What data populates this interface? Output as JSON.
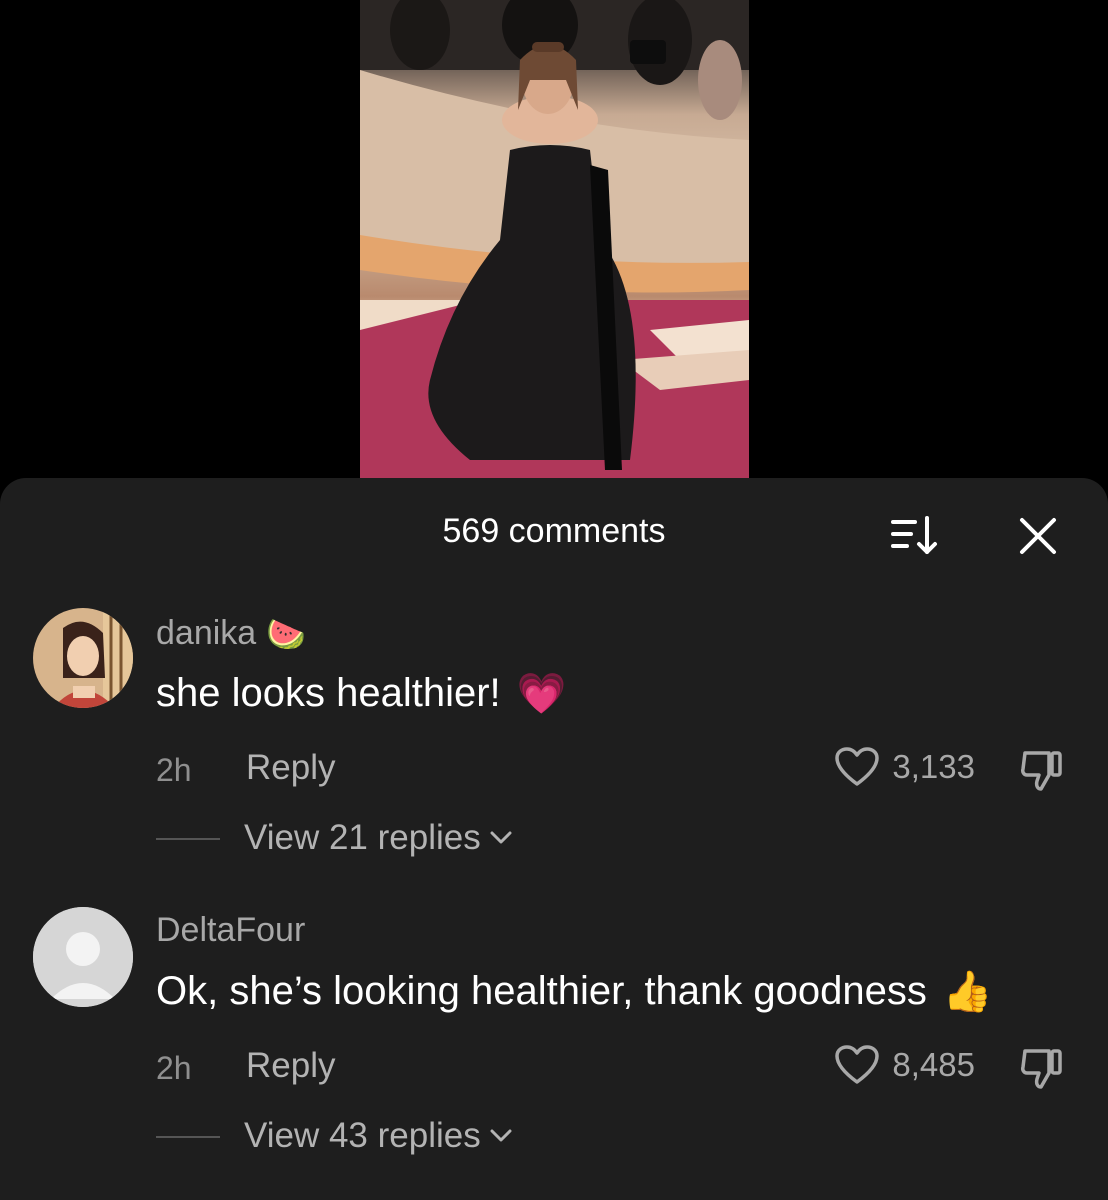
{
  "video": {
    "description_icon": "video-thumbnail"
  },
  "comments_sheet": {
    "count_label": "569 comments",
    "sort_icon": "sort-icon",
    "close_icon": "close-icon"
  },
  "comments": [
    {
      "username": "danika",
      "username_emoji": "🍉",
      "text": "she looks healthier!",
      "text_emoji": "💗",
      "time": "2h",
      "reply_label": "Reply",
      "likes": "3,133",
      "view_replies": "View 21 replies"
    },
    {
      "username": "DeltaFour",
      "username_emoji": "",
      "text": "Ok, she’s looking healthier, thank goodness",
      "text_emoji": "👍",
      "time": "2h",
      "reply_label": "Reply",
      "likes": "8,485",
      "view_replies": "View 43 replies"
    }
  ]
}
